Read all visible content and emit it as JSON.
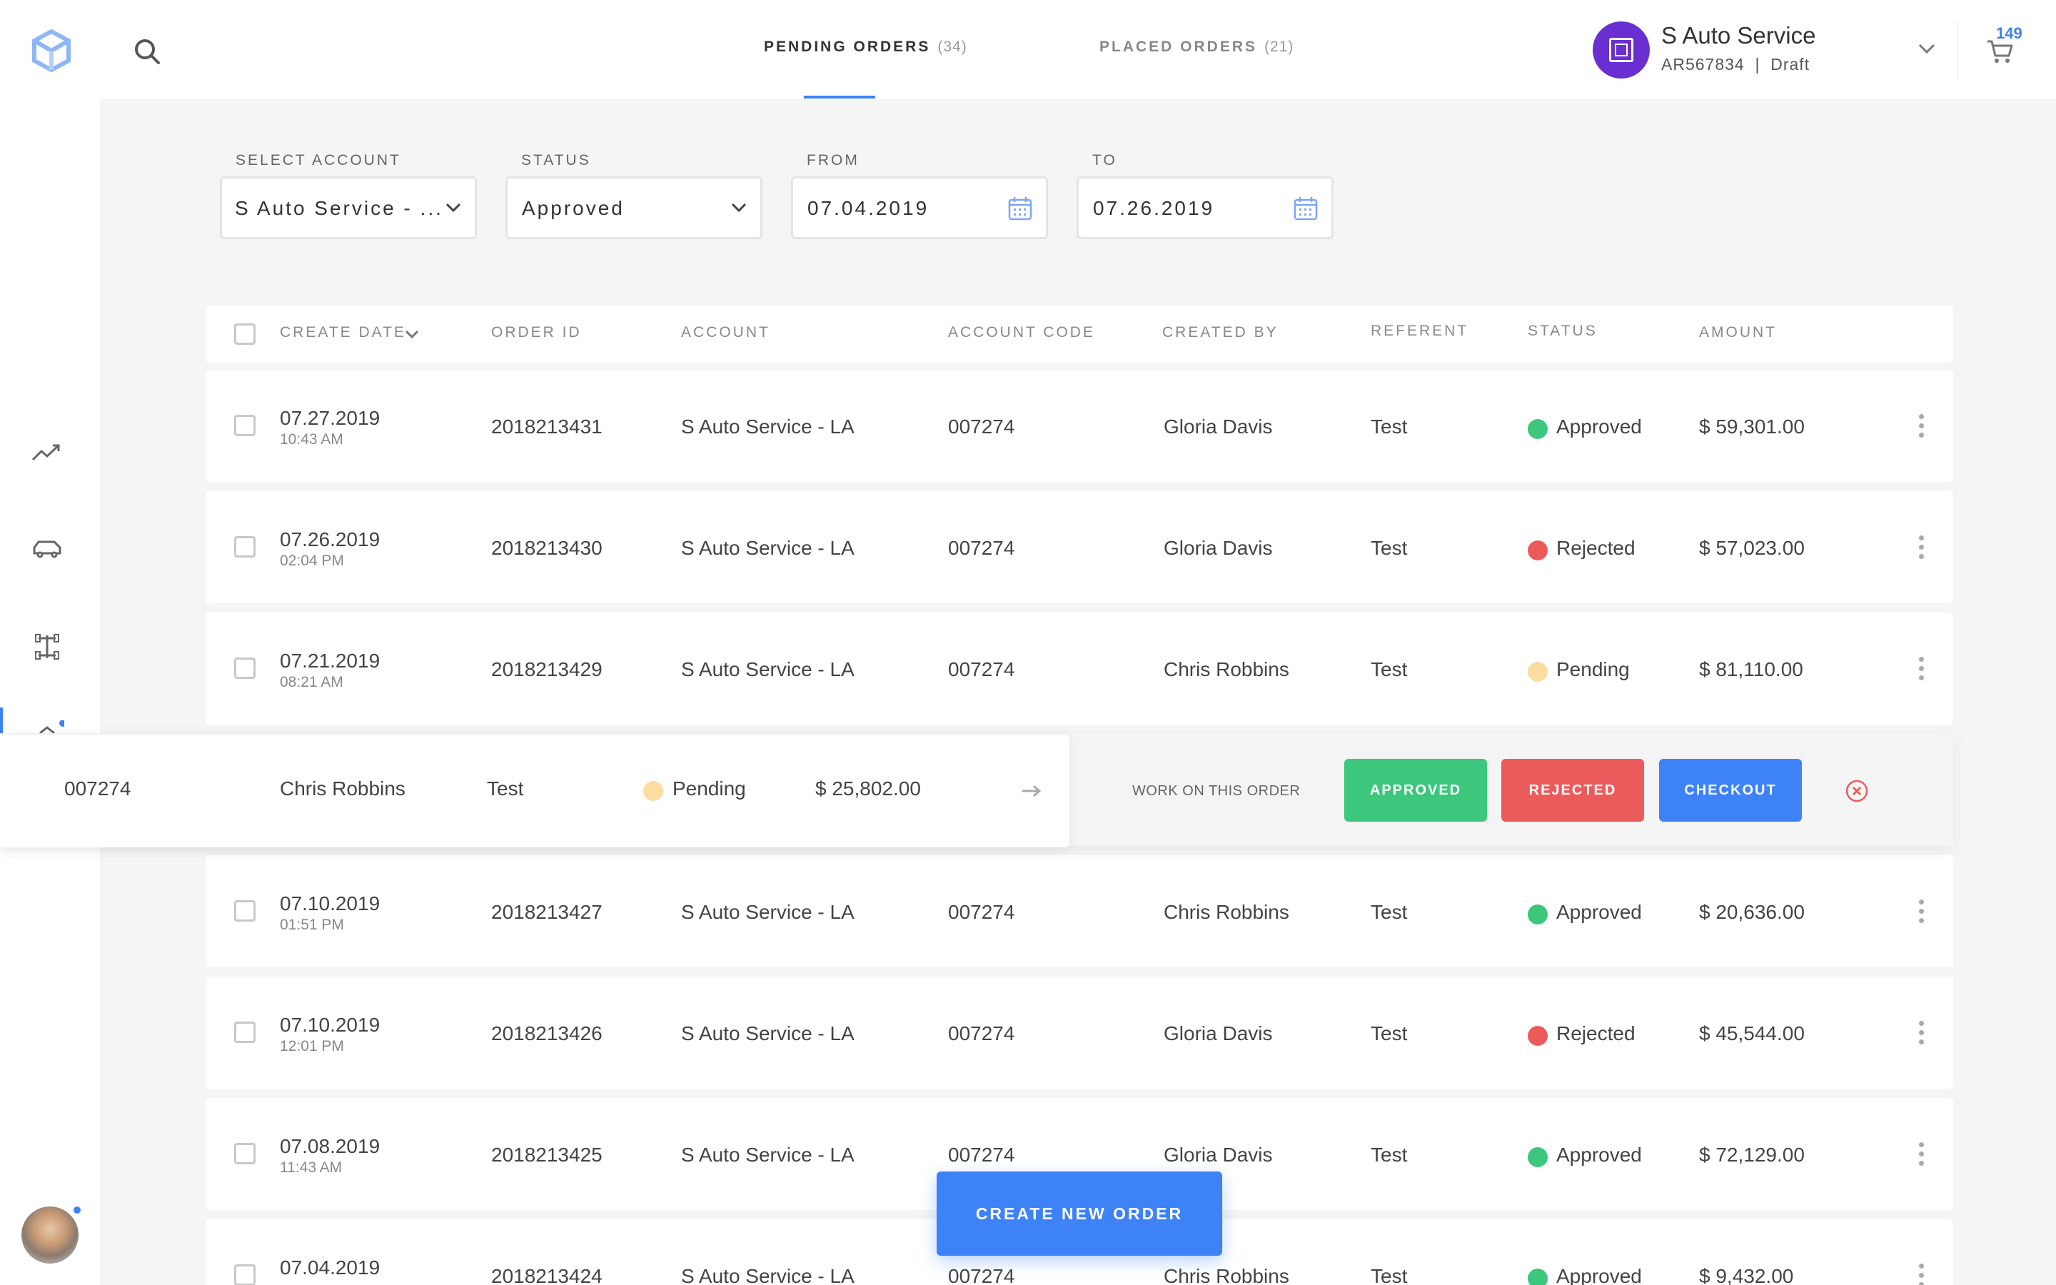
{
  "header": {
    "tabs": [
      {
        "label": "PENDING ORDERS",
        "count": "(34)"
      },
      {
        "label": "PLACED ORDERS",
        "count": "(21)"
      }
    ],
    "account": {
      "name": "S Auto Service",
      "sub": "AR567834  |  Draft"
    },
    "cart_count": "149"
  },
  "filters": {
    "account": {
      "label": "SELECT ACCOUNT",
      "value": "S Auto Service  - ..."
    },
    "status": {
      "label": "STATUS",
      "value": "Approved"
    },
    "from": {
      "label": "FROM",
      "value": "07.04.2019"
    },
    "to": {
      "label": "TO",
      "value": "07.26.2019"
    }
  },
  "table": {
    "columns": [
      "CREATE DATE",
      "ORDER ID",
      "ACCOUNT",
      "ACCOUNT CODE",
      "CREATED BY",
      "REFERENT",
      "STATUS",
      "AMOUNT"
    ],
    "rows": [
      {
        "date": "07.27.2019",
        "time": "10:43 AM",
        "order_id": "2018213431",
        "account": "S Auto Service - LA",
        "code": "007274",
        "created_by": "Gloria Davis",
        "referent": "Test",
        "status": "Approved",
        "amount": "$ 59,301.00"
      },
      {
        "date": "07.26.2019",
        "time": "02:04 PM",
        "order_id": "2018213430",
        "account": "S Auto Service - LA",
        "code": "007274",
        "created_by": "Gloria Davis",
        "referent": "Test",
        "status": "Rejected",
        "amount": "$ 57,023.00"
      },
      {
        "date": "07.21.2019",
        "time": "08:21 AM",
        "order_id": "2018213429",
        "account": "S Auto Service - LA",
        "code": "007274",
        "created_by": "Chris Robbins",
        "referent": "Test",
        "status": "Pending",
        "amount": "$ 81,110.00"
      },
      {
        "date": "07.10.2019",
        "time": "01:51 PM",
        "order_id": "2018213427",
        "account": "S Auto Service - LA",
        "code": "007274",
        "created_by": "Chris Robbins",
        "referent": "Test",
        "status": "Approved",
        "amount": "$ 20,636.00"
      },
      {
        "date": "07.10.2019",
        "time": "12:01 PM",
        "order_id": "2018213426",
        "account": "S Auto Service - LA",
        "code": "007274",
        "created_by": "Gloria Davis",
        "referent": "Test",
        "status": "Rejected",
        "amount": "$ 45,544.00"
      },
      {
        "date": "07.08.2019",
        "time": "11:43 AM",
        "order_id": "2018213425",
        "account": "S Auto Service - LA",
        "code": "007274",
        "created_by": "Gloria Davis",
        "referent": "Test",
        "status": "Approved",
        "amount": "$ 72,129.00"
      },
      {
        "date": "07.04.2019",
        "time": "",
        "order_id": "2018213424",
        "account": "S Auto Service - LA",
        "code": "007274",
        "created_by": "Chris Robbins",
        "referent": "Test",
        "status": "Approved",
        "amount": "$ 9,432.00"
      }
    ],
    "expanded_row": {
      "code": "007274",
      "created_by": "Chris Robbins",
      "referent": "Test",
      "status": "Pending",
      "amount": "$ 25,802.00"
    }
  },
  "actions": {
    "work_label": "WORK ON THIS ORDER",
    "approved": "APPROVED",
    "rejected": "REJECTED",
    "checkout": "CHECKOUT",
    "create_new_order": "CREATE NEW ORDER"
  },
  "status_colors": {
    "Approved": "#3cc77c",
    "Rejected": "#ec5b5b",
    "Pending": "#fddca0"
  },
  "icons": [
    "logo-icon",
    "search-icon",
    "trend-icon",
    "car-icon",
    "chassis-icon",
    "ship-icon",
    "chevron-down-icon",
    "cart-icon",
    "calendar-icon",
    "kebab-menu-icon",
    "arrow-right-icon",
    "close-icon"
  ],
  "accent_color": "#3d82f7"
}
